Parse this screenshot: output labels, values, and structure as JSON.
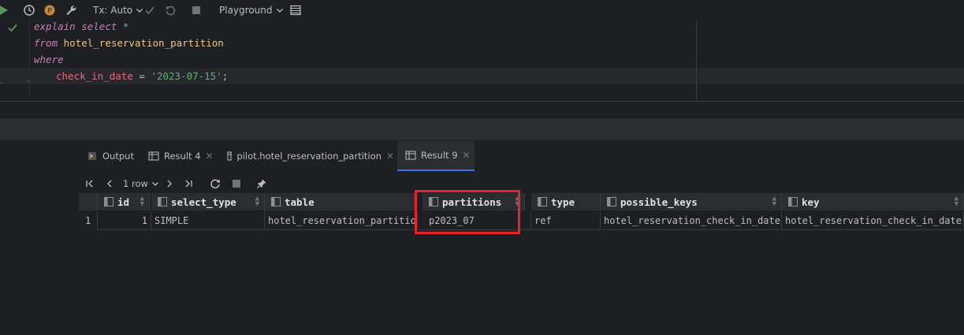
{
  "toolbar": {
    "tx_mode": "Tx: Auto",
    "schema": "Playground",
    "badge": "P"
  },
  "editor": {
    "line1_kw1": "explain",
    "line1_kw2": "select",
    "line1_star": "*",
    "line2_kw": "from",
    "line2_table": "hotel_reservation_partition",
    "line3_kw": "where",
    "line4_col": "check_in_date",
    "line4_op": " = ",
    "line4_str": "'2023-07-15'",
    "line4_end": ";"
  },
  "tabs": [
    {
      "label": "Output"
    },
    {
      "label": "Result 4"
    },
    {
      "label": "pilot.hotel_reservation_partition"
    },
    {
      "label": "Result 9"
    }
  ],
  "nav": {
    "rows": "1 row"
  },
  "grid": {
    "columns": [
      "id",
      "select_type",
      "table",
      "partitions",
      "type",
      "possible_keys",
      "key"
    ],
    "rows": [
      {
        "num": "1",
        "cells": [
          "1",
          "SIMPLE",
          "hotel_reservation_partition",
          "p2023_07",
          "ref",
          "hotel_reservation_check_in_date",
          "hotel_reservation_check_in_date"
        ]
      }
    ]
  },
  "colors": {
    "accent": "#3574f0",
    "highlight": "#e8212a"
  }
}
